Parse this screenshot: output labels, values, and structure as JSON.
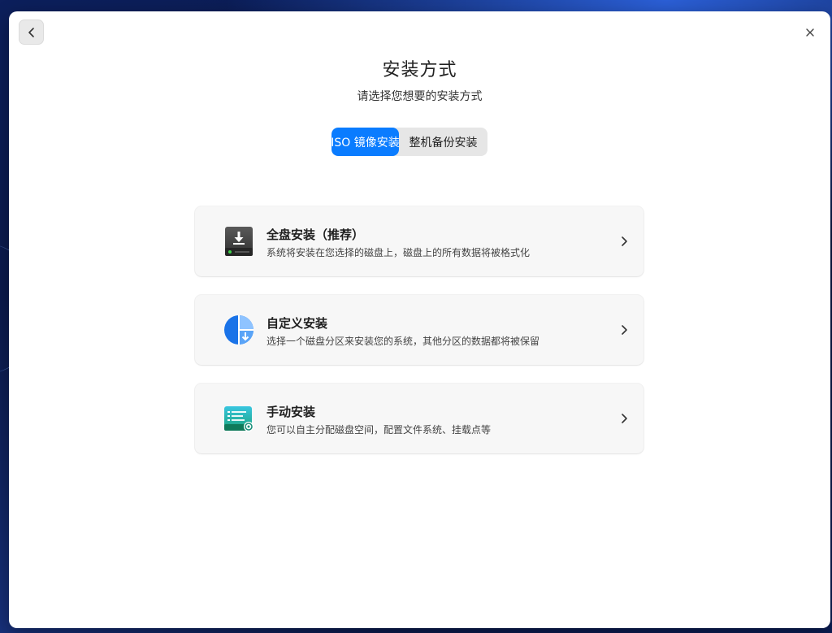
{
  "window": {
    "title": "安装方式",
    "subtitle": "请选择您想要的安装方式"
  },
  "tabs": [
    {
      "label": "ISO 镜像安装",
      "active": true
    },
    {
      "label": "整机备份安装",
      "active": false
    }
  ],
  "options": [
    {
      "icon": "disk-download-icon",
      "title": "全盘安装（推荐）",
      "description": "系统将安装在您选择的磁盘上，磁盘上的所有数据将被格式化"
    },
    {
      "icon": "partition-pie-icon",
      "title": "自定义安装",
      "description": "选择一个磁盘分区来安装您的系统，其他分区的数据都将被保留"
    },
    {
      "icon": "manual-disk-settings-icon",
      "title": "手动安装",
      "description": "您可以自主分配磁盘空间，配置文件系统、挂载点等"
    }
  ],
  "colors": {
    "accent": "#0a7cff",
    "card_bg": "#f7f7f7",
    "tab_bg": "#e6e6e6"
  }
}
